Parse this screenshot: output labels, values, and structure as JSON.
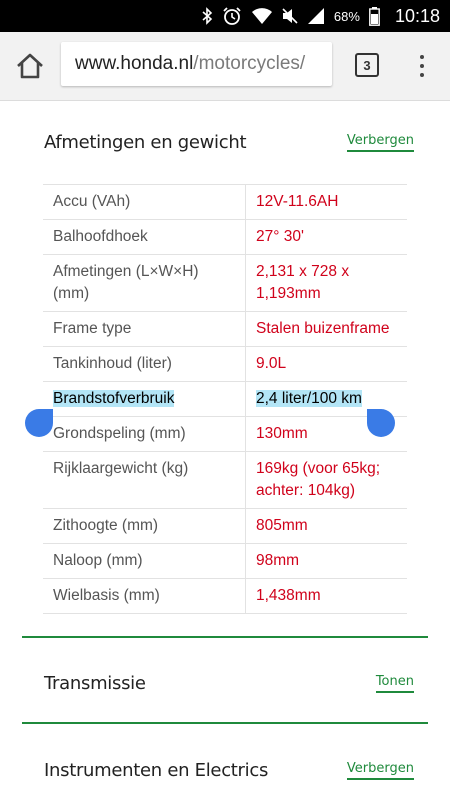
{
  "status_bar": {
    "icons": [
      "bluetooth-icon",
      "alarm-icon",
      "wifi-icon",
      "mute-icon",
      "signal-icon",
      "battery-icon"
    ],
    "battery": "68%",
    "time": "10:18"
  },
  "browser": {
    "url_host": "www.honda.nl",
    "url_path": "/motorcycles/",
    "tab_count": "3"
  },
  "sections": [
    {
      "title": "Afmetingen en gewicht",
      "toggle": "Verbergen"
    },
    {
      "title": "Transmissie",
      "toggle": "Tonen"
    },
    {
      "title": "Instrumenten en Electrics",
      "toggle": "Verbergen"
    }
  ],
  "specs": {
    "rows": [
      {
        "label": "Accu (VAh)",
        "value": "12V-11.6AH"
      },
      {
        "label": "Balhoofdhoek",
        "value": "27° 30'"
      },
      {
        "label": "Afmetingen (L×W×H) (mm)",
        "value": "2,131 x 728 x 1,193mm"
      },
      {
        "label": "Frame type",
        "value": "Stalen buizenframe"
      },
      {
        "label": "Tankinhoud (liter)",
        "value": "9.0L"
      },
      {
        "label": "Brandstofverbruik",
        "value": "2,4 liter/100 km"
      },
      {
        "label": "Grondspeling (mm)",
        "value": "130mm"
      },
      {
        "label": "Rijklaargewicht (kg)",
        "value": "169kg (voor 65kg; achter: 104kg)"
      },
      {
        "label": "Zithoogte (mm)",
        "value": "805mm"
      },
      {
        "label": "Naloop (mm)",
        "value": "98mm"
      },
      {
        "label": "Wielbasis (mm)",
        "value": "1,438mm"
      }
    ],
    "selected_row": "Brandstofverbruik"
  },
  "colors": {
    "accent_green": "#1f8a3c",
    "value_red": "#d0021b",
    "selection": "#b3e5f6",
    "handle_blue": "#3a7be6"
  }
}
